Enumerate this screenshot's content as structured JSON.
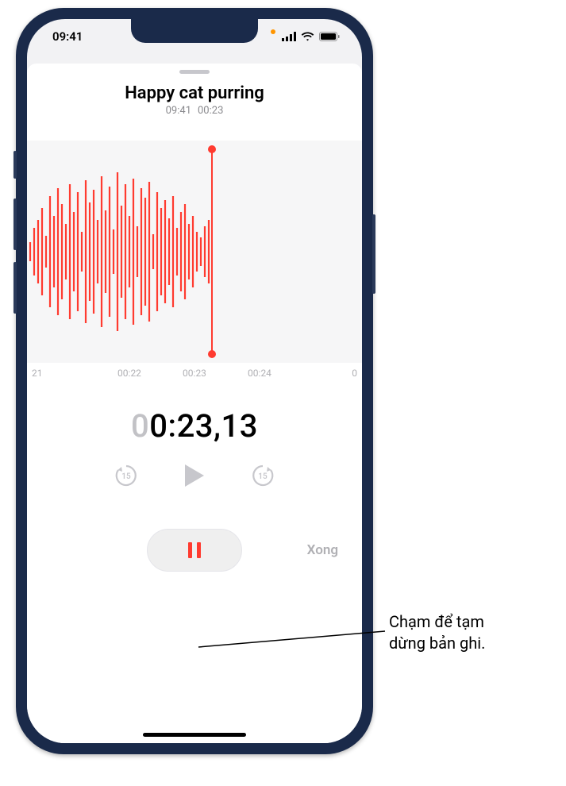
{
  "status": {
    "time": "09:41"
  },
  "recording": {
    "title": "Happy cat purring",
    "start_time": "09:41",
    "duration": "00:23"
  },
  "ruler": {
    "t0": "21",
    "t1": "00:22",
    "t2": "00:23",
    "t3": "00:24",
    "t4": "0"
  },
  "timer": {
    "prefix": "0",
    "main": "0:23,13"
  },
  "controls": {
    "done_label": "Xong"
  },
  "callout": {
    "line1": "Chạm để tạm",
    "line2": "dừng bản ghi."
  },
  "icons": {
    "skip_back": "15",
    "skip_fwd": "15"
  }
}
